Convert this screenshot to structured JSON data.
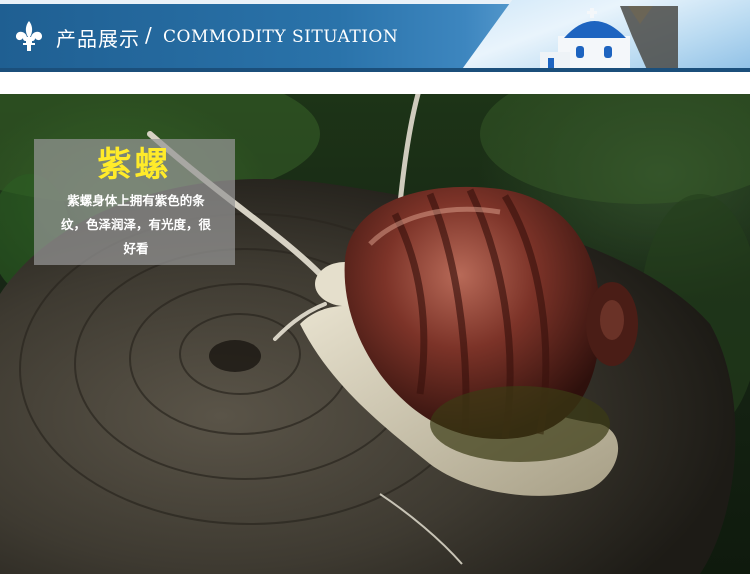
{
  "header": {
    "title_cn": "产品展示",
    "separator": "/",
    "title_en": "COMMODITY SITUATION",
    "icons": {
      "emblem": "fleur-de-lis-icon",
      "decoration": "blue-dome-church-icon"
    },
    "colors": {
      "banner": "#2a73aa",
      "banner_dark": "#1b4f7b",
      "text": "#ffffff"
    }
  },
  "product": {
    "name": "紫螺",
    "description": "紫螺身体上拥有紫色的条纹，色泽润泽，有光度，很好看",
    "colors": {
      "name": "#ffeb2a",
      "description": "#ffffff"
    }
  }
}
